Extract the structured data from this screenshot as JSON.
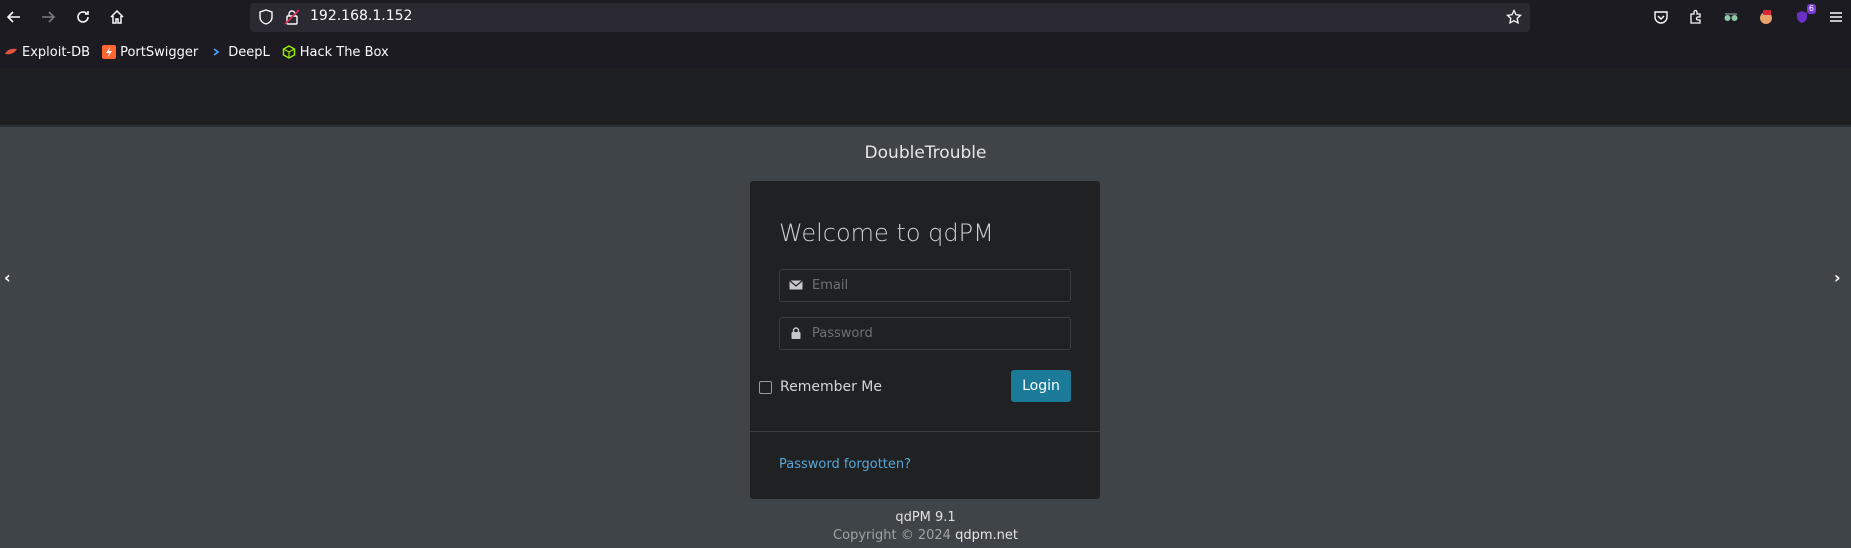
{
  "browser": {
    "url": "192.168.1.152",
    "bookmarks": [
      {
        "label": "Exploit-DB",
        "icon": "exploit-db-icon",
        "color": "#e8553e"
      },
      {
        "label": "PortSwigger",
        "icon": "portswigger-icon",
        "color": "#ff6633"
      },
      {
        "label": "DeepL",
        "icon": "deepl-icon",
        "color": "#4aa3ff"
      },
      {
        "label": "Hack The Box",
        "icon": "hackthebox-icon",
        "color": "#9fef00"
      }
    ],
    "extension_badge": "6"
  },
  "page": {
    "site_title": "DoubleTrouble",
    "login": {
      "heading": "Welcome to qdPM",
      "email_placeholder": "Email",
      "password_placeholder": "Password",
      "remember_label": "Remember Me",
      "login_button": "Login",
      "forgot_link": "Password forgotten?"
    },
    "footer": {
      "version": "qdPM 9.1",
      "copyright_prefix": "Copyright © 2024",
      "copyright_link": "qdpm.net"
    }
  },
  "colors": {
    "accent": "#1a7a98",
    "link": "#5aa6d6",
    "background": "#3e4447"
  }
}
